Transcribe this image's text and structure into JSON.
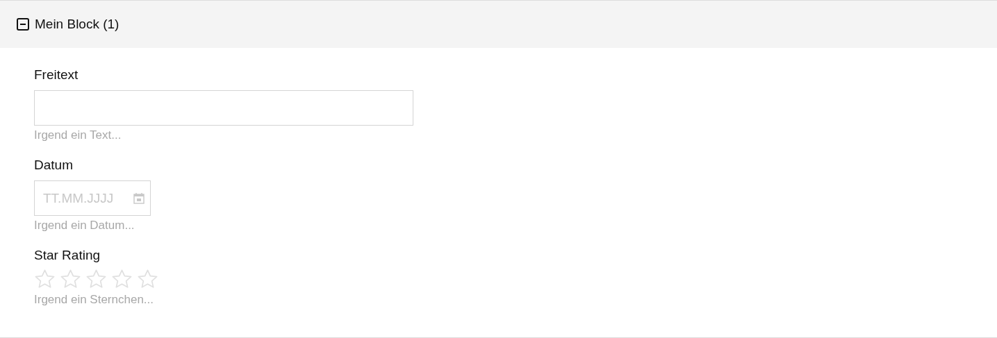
{
  "block": {
    "title": "Mein Block (1)",
    "expanded": true,
    "fields": [
      {
        "kind": "text",
        "label": "Freitext",
        "hint": "Irgend ein Text..."
      },
      {
        "kind": "date",
        "label": "Datum",
        "placeholder": "TT.MM.JJJJ",
        "hint": "Irgend ein Datum..."
      },
      {
        "kind": "rating",
        "label": "Star Rating",
        "stars": 0,
        "hint": "Irgend ein Sternchen..."
      }
    ]
  }
}
